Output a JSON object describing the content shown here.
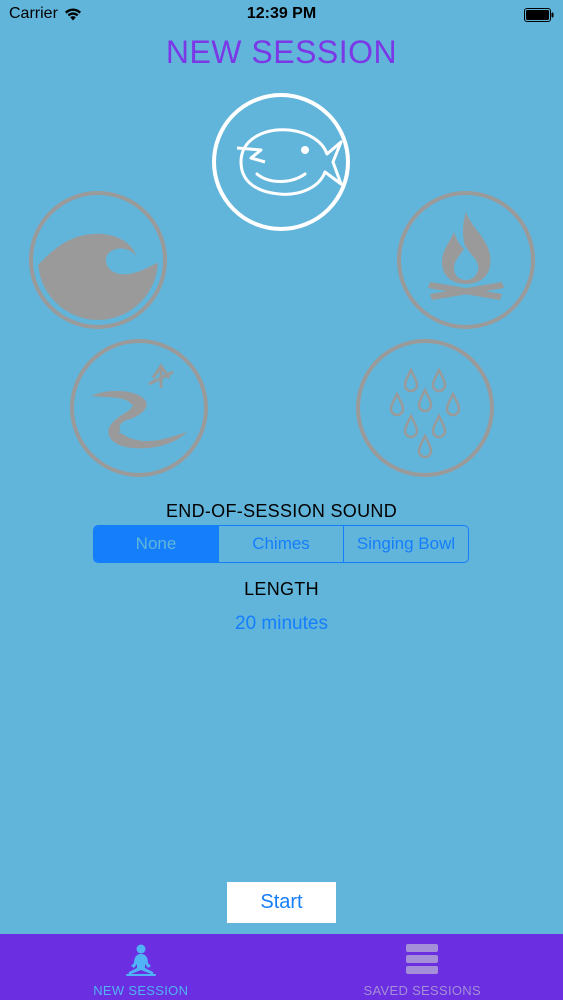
{
  "status_bar": {
    "carrier": "Carrier",
    "time": "12:39 PM"
  },
  "header": {
    "title": "NEW SESSION"
  },
  "sounds": [
    {
      "id": "bird",
      "icon": "bird-icon",
      "selected": true
    },
    {
      "id": "wave",
      "icon": "ocean-wave-icon",
      "selected": false
    },
    {
      "id": "fire",
      "icon": "campfire-icon",
      "selected": false
    },
    {
      "id": "river",
      "icon": "river-icon",
      "selected": false
    },
    {
      "id": "rain",
      "icon": "raindrops-icon",
      "selected": false
    }
  ],
  "end_sound": {
    "label": "END-OF-SESSION SOUND",
    "options": [
      "None",
      "Chimes",
      "Singing Bowl"
    ],
    "selected": "None"
  },
  "length": {
    "label": "LENGTH",
    "value": "20 minutes"
  },
  "start_button": {
    "label": "Start"
  },
  "tab_bar": {
    "tabs": [
      {
        "label": "NEW SESSION",
        "icon": "meditation-icon",
        "active": true
      },
      {
        "label": "SAVED SESSIONS",
        "icon": "stack-icon",
        "active": false
      }
    ]
  },
  "colors": {
    "background": "#62b5da",
    "accent_purple": "#7a38e6",
    "tab_bar": "#6b2ee0",
    "ios_blue": "#147efb",
    "inactive_icon_gray": "#9a9a9a",
    "selected_icon_white": "#ffffff"
  }
}
